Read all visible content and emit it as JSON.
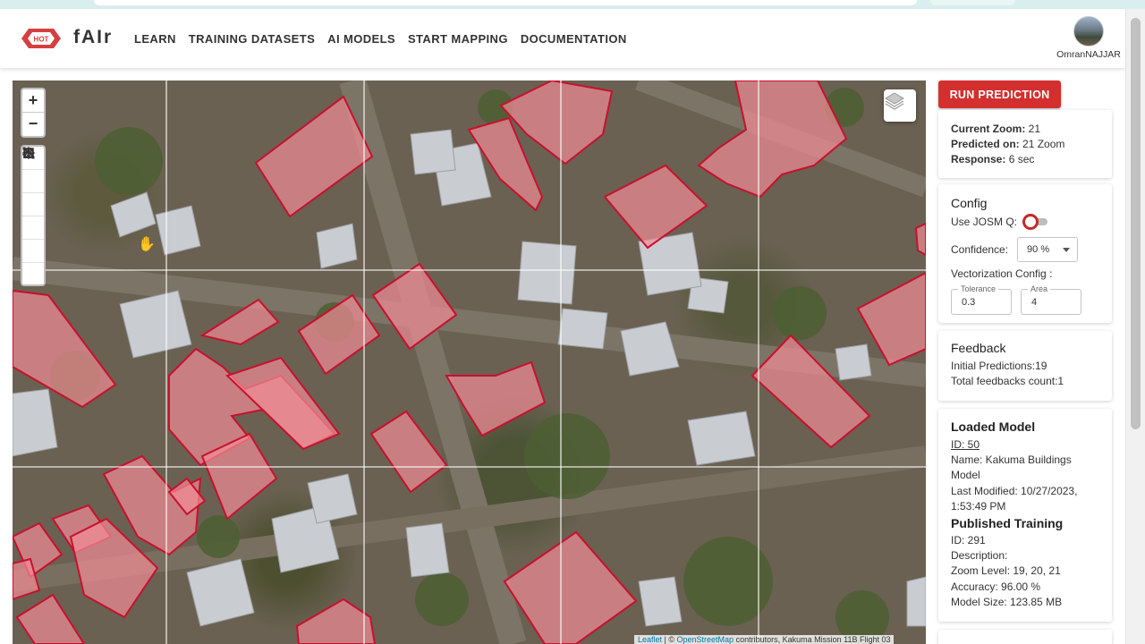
{
  "app": {
    "brand": "fAIr",
    "logo_text": "HOT"
  },
  "nav": {
    "items": [
      "LEARN",
      "TRAINING DATASETS",
      "AI MODELS",
      "START MAPPING",
      "DOCUMENTATION"
    ]
  },
  "user": {
    "name": "OmranNAJJAR"
  },
  "map": {
    "zoom_in": "+",
    "zoom_out": "−",
    "tools": [
      "rectangle-icon",
      "polygon-draw-icon",
      "edit-vertices-icon",
      "move-icon",
      "erase-icon",
      "rotate-icon"
    ],
    "attribution": {
      "leaflet": "Leaflet",
      "separator": " | © ",
      "osm": "OpenStreetMap",
      "rest": " contributors, Kakuma Mission 11B Flight 03"
    }
  },
  "panel": {
    "run_button": "RUN PREDICTION",
    "status": {
      "zoom_label": "Current Zoom:",
      "zoom_value": "21",
      "predicted_label": "Predicted on:",
      "predicted_value": "21 Zoom",
      "response_label": "Response:",
      "response_value": "6 sec"
    },
    "config": {
      "title": "Config",
      "josm_label": "Use JOSM Q:",
      "confidence_label": "Confidence:",
      "confidence_value": "90 %",
      "vectorization_label": "Vectorization Config :",
      "tolerance_label": "Tolerance",
      "tolerance_value": "0.3",
      "area_label": "Area",
      "area_value": "4"
    },
    "feedback": {
      "title": "Feedback",
      "initial": "Initial Predictions:19",
      "total": "Total feedbacks count:1"
    },
    "model": {
      "title": "Loaded Model",
      "id": "ID: 50",
      "name_line1": "Name: Kakuma Buildings",
      "name_line2": "Model",
      "modified_line1": "Last Modified: 10/27/2023,",
      "modified_line2": "1:53:49 PM",
      "training_title": "Published Training",
      "training_id": "ID: 291",
      "description": "Description:",
      "zoom_levels": "Zoom Level: 19, 20, 21",
      "accuracy": "Accuracy: 96.00 %",
      "size": "Model Size: 123.85 MB"
    }
  }
}
